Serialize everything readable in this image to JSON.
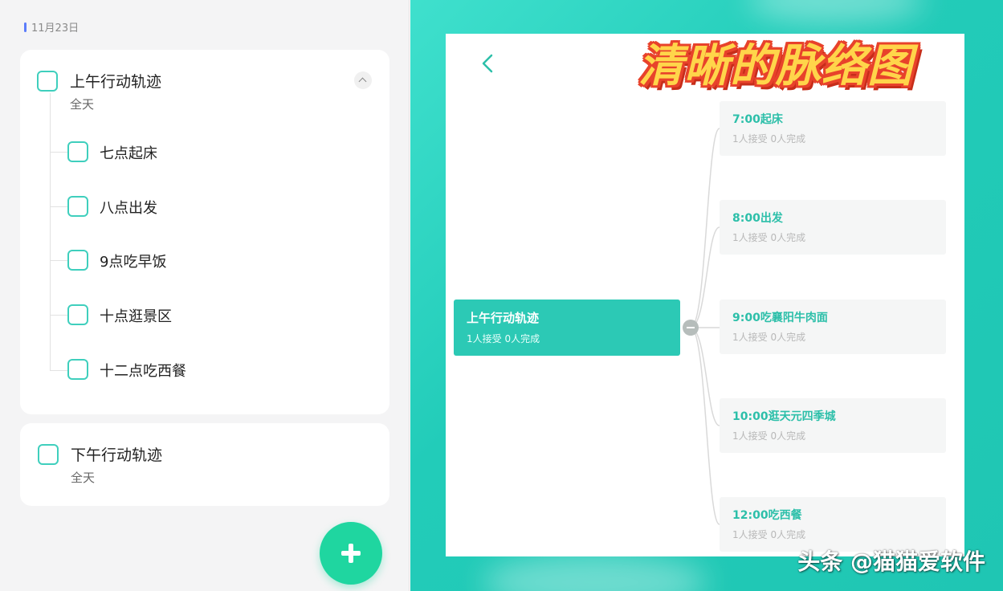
{
  "left": {
    "date": "11月23日",
    "card1": {
      "title": "上午行动轨迹",
      "subtitle": "全天",
      "subtasks": [
        "七点起床",
        "八点出发",
        "9点吃早饭",
        "十点逛景区",
        "十二点吃西餐"
      ]
    },
    "card2": {
      "title": "下午行动轨迹",
      "subtitle": "全天"
    }
  },
  "right": {
    "promo": "清晰的脉络图",
    "root": {
      "title": "上午行动轨迹",
      "sub": "1人接受 0人完成"
    },
    "children": [
      {
        "title": "7:00起床",
        "sub": "1人接受 0人完成"
      },
      {
        "title": "8:00出发",
        "sub": "1人接受 0人完成"
      },
      {
        "title": "9:00吃襄阳牛肉面",
        "sub": "1人接受 0人完成"
      },
      {
        "title": "10:00逛天元四季城",
        "sub": "1人接受 0人完成"
      },
      {
        "title": "12:00吃西餐",
        "sub": "1人接受 0人完成"
      }
    ],
    "watermark": "头条 @猫猫爱软件"
  },
  "colors": {
    "accent": "#2cc9b5",
    "checkbox": "#3fcfbd",
    "fab": "#1fd6a0",
    "date_marker": "#5b7cfa"
  }
}
